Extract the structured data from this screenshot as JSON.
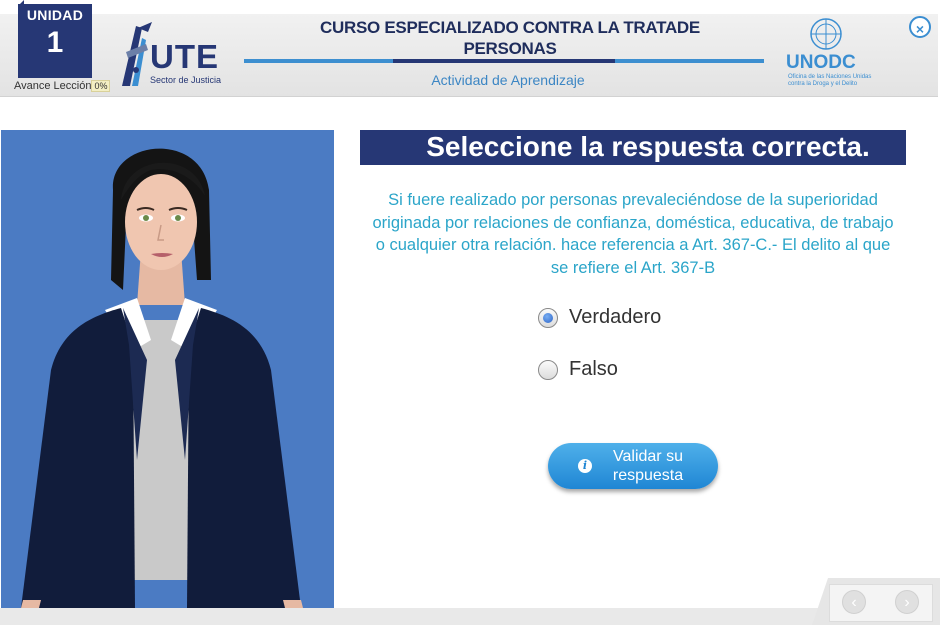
{
  "header": {
    "unit_label": "UNIDAD",
    "unit_number": "1",
    "progress_label": "Avance Lección",
    "progress_value": "0%",
    "ute_logo": "UTE",
    "ute_subtitle": "Sector de Justicia",
    "course_title": "CURSO ESPECIALIZADO CONTRA LA TRATADE PERSONAS",
    "activity_label": "Actividad de Aprendizaje",
    "unodc_logo": "UNODC",
    "unodc_subtitle": "Oficina de las Naciones Unidas contra la Droga y el Delito",
    "close_icon": "close-icon"
  },
  "question": {
    "prompt": "Seleccione la respuesta correcta.",
    "text": "Si fuere realizado por personas prevaleciéndose de la superioridad originada por relaciones de confianza, doméstica, educativa, de trabajo o cualquier otra relación.  hace referencia a Art. 367-C.- El delito al que se refiere el Art. 367-B",
    "options": [
      {
        "label": "Verdadero",
        "selected": true
      },
      {
        "label": "Falso",
        "selected": false
      }
    ],
    "validate_label": "Validar su respuesta",
    "validate_icon": "info-icon"
  },
  "footer": {
    "prev_icon": "chevron-left-icon",
    "next_icon": "chevron-right-icon"
  },
  "colors": {
    "navy": "#263775",
    "accent_blue": "#3b8ed1",
    "question_text": "#2ba5c9",
    "avatar_bg": "#4b7bc3"
  }
}
